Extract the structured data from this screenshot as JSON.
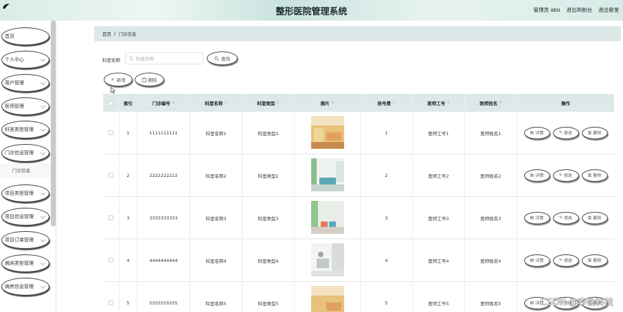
{
  "header": {
    "title": "整形医院管理系统",
    "admin": "管理员 abo",
    "back_front": "退出到前台",
    "logout": "退出登录"
  },
  "sidebar": {
    "items": [
      {
        "label": "首页",
        "has_chevron": false
      },
      {
        "label": "个人中心",
        "has_chevron": true
      },
      {
        "label": "用户管理",
        "has_chevron": true
      },
      {
        "label": "医师管理",
        "has_chevron": true
      },
      {
        "label": "科室类型管理",
        "has_chevron": true
      },
      {
        "label": "门诊信息管理",
        "has_chevron": true
      },
      {
        "label": "项目类型管理",
        "has_chevron": true
      },
      {
        "label": "项目信息管理",
        "has_chevron": true
      },
      {
        "label": "项目订单管理",
        "has_chevron": true
      },
      {
        "label": "病床类型管理",
        "has_chevron": true
      },
      {
        "label": "病房信息管理",
        "has_chevron": true
      }
    ],
    "submenu_item": "门诊信息"
  },
  "breadcrumb": {
    "home": "首页",
    "separator": "/",
    "current": "门诊信息"
  },
  "search": {
    "label": "科室名称",
    "placeholder": "科室名称",
    "button": "查询"
  },
  "toolbar": {
    "add": "新增",
    "delete": "删除"
  },
  "table": {
    "columns": [
      "索引",
      "门诊编号",
      "科室名称",
      "科室类型",
      "图片",
      "挂号费",
      "医师工号",
      "医师姓名",
      "操作"
    ],
    "rows": [
      {
        "index": "1",
        "code": "1111111111",
        "dept": "科室名称1",
        "type": "科室类型1",
        "fee": "1",
        "doc_id": "医师工号1",
        "doc_name": "医师姓名1"
      },
      {
        "index": "2",
        "code": "2222222222",
        "dept": "科室名称2",
        "type": "科室类型2",
        "fee": "2",
        "doc_id": "医师工号2",
        "doc_name": "医师姓名2"
      },
      {
        "index": "3",
        "code": "3333333333",
        "dept": "科室名称3",
        "type": "科室类型3",
        "fee": "3",
        "doc_id": "医师工号3",
        "doc_name": "医师姓名3"
      },
      {
        "index": "4",
        "code": "4444444444",
        "dept": "科室名称4",
        "type": "科室类型4",
        "fee": "4",
        "doc_id": "医师工号4",
        "doc_name": "医师姓名4"
      },
      {
        "index": "5",
        "code": "5555555555",
        "dept": "科室名称5",
        "type": "科室类型5",
        "fee": "5",
        "doc_id": "医师工号5",
        "doc_name": "医师姓名5"
      }
    ],
    "actions": {
      "detail": "详情",
      "edit": "修改",
      "delete": "删除"
    }
  },
  "watermark": "CSDN @李会科技",
  "colors": {
    "header_bg": "#d9ece8",
    "table_head_bg": "#dde9e8",
    "breadcrumb_bg": "#dde9e8"
  }
}
